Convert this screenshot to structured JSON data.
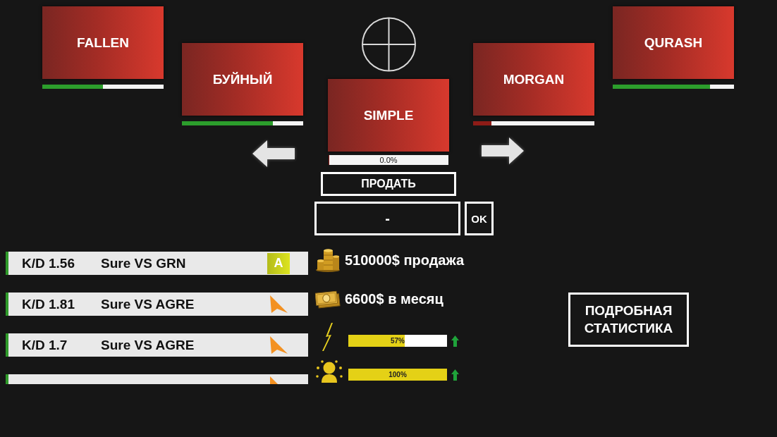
{
  "carousel": {
    "left": [
      {
        "name": "FALLEN",
        "level": 0.5
      },
      {
        "name": "БУЙНЫЙ",
        "level": 0.75
      }
    ],
    "current": {
      "name": "SIMPLE",
      "level": 0,
      "reading": "0.0%"
    },
    "right": [
      {
        "name": "MORGAN",
        "level": 0.15
      },
      {
        "name": "QURASH",
        "level": 0.8
      }
    ]
  },
  "sell_button": "ПРОДАТЬ",
  "price_input": {
    "value": "-"
  },
  "ok_button": "OK",
  "matches": [
    {
      "kd": "K/D 1.56",
      "match": "Sure VS GRN",
      "kind": "badge",
      "badge": "A"
    },
    {
      "kd": "K/D 1.81",
      "match": "Sure VS AGRE",
      "kind": "pointer"
    },
    {
      "kd": "K/D 1.7",
      "match": "Sure VS AGRE",
      "kind": "pointer"
    },
    {
      "kind": "pointer"
    }
  ],
  "finances": [
    {
      "text": "510000$ продажа"
    },
    {
      "text": "6600$ в месяц"
    }
  ],
  "meters": [
    {
      "level": 0.57,
      "reading": "57%",
      "rising": true
    },
    {
      "level": 1,
      "reading": "100%",
      "rising": true
    }
  ],
  "details_button": "ПОДРОБНАЯ СТАТИСТИКА"
}
